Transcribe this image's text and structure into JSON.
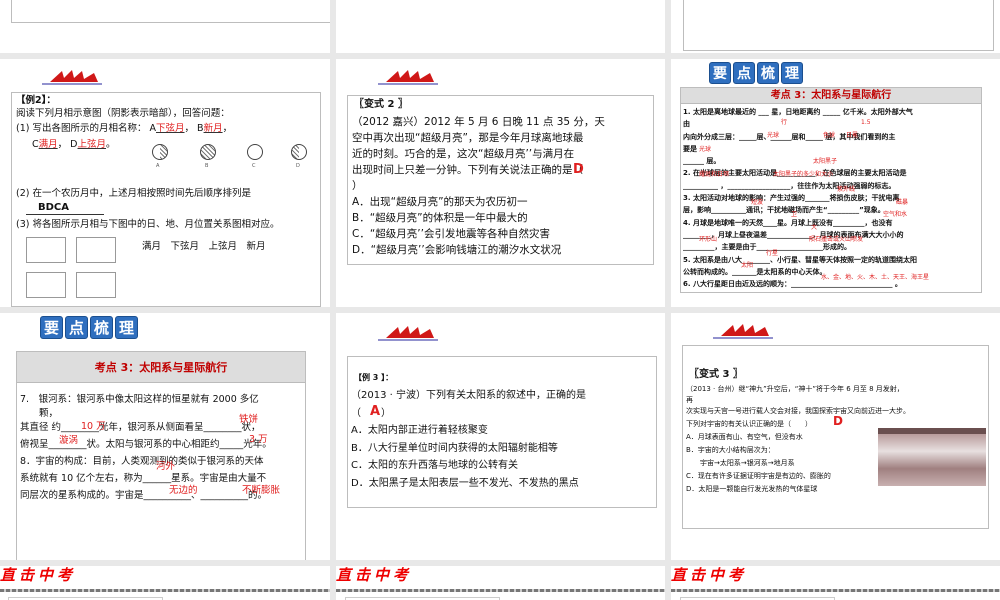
{
  "slides": {
    "ex2": {
      "title": "【例2】：",
      "intro": "阅读下列月相示意图（阴影表示暗部），回答问题：",
      "q1a": "(1) 写出各图所示的月相名称： A",
      "q1b": "， B",
      "q1c": "C",
      "q1d": "， D",
      "a1": "下弦月",
      "a2": "新月",
      "a3": "满月",
      "a4": "上弦月",
      "labels": [
        "A",
        "B",
        "C",
        "D"
      ],
      "q2": "(2) 在一个农历月中，上述月相按照时间先后顺序排列是",
      "a_order": "BDCA",
      "q3": "(3) 将各图所示月相与下图中的日、地、月位置关系图相对应。",
      "match": "满月　下弦月　上弦月　新月"
    },
    "v2": {
      "title": "〖变式 2 〗",
      "lines": [
        "（2012 嘉兴）2012 年 5 月 6 日晚 11 点 35 分，天",
        "空中再次出现“超级月亮”，那是今年月球离地球最",
        "近的时刻。巧合的是，这次“超级月亮’’与满月在",
        "出现时间上只差一分钟。下列有关说法正确的是（",
        "）"
      ],
      "answer": "D",
      "options": [
        "A．出现“超级月亮”的那天为农历初一",
        "B．“超级月亮”的体积是一年中最大的",
        "C．“超级月亮’’会引发地震等各种自然灾害",
        "D．“超级月亮’’会影响钱塘江的潮汐水文状况"
      ]
    },
    "review1": {
      "tiles": [
        "要",
        "点",
        "梳",
        "理"
      ],
      "header": "考点 3：太阳系与星际航行",
      "lines": [
        "1. 太阳是离地球最近的 ___ 星，日地距离约 _____ 亿千米。太阳外部大气",
        "   由",
        "   内向外分成三层：_____层、______层和_____ 层，其中我们看到的主",
        "   要是",
        "______ 层。",
        "2. 在光球层的主要太阳活动是___________，在色球层的主要太阳活动是",
        "   __________ ，__________________，往往作为太阳活动强弱的标志。",
        "3. 太阳活动对地球的影响：产生过强的_______将损伤皮肤；干扰电离",
        "   层，影响__________通讯；干扰地磁场而产生“_________”现象。",
        "4. 月球是地球唯一的天然____星。月球上既没有_________，也没有",
        "   ________，月球上昼夜温差_____________，月球的表面布满大大小小的",
        "   _________，主要是由于___________________形成的。",
        "5. 太阳系是由八大________、小行星、彗星等天体按照一定的轨道围绕太阳",
        "   公转而构成的。_______是太阳系的中心天体。",
        "6. 八大行星距日由近及远的顺为：_____________________________ 。"
      ],
      "answers": [
        "行",
        "1.5",
        "光球",
        "色球",
        "日冕",
        "光球",
        "太阳黑子",
        "耀斑和日珥",
        "太阳黑子的多少和大小",
        "紫外线",
        "短波",
        "磁暴",
        "卫",
        "空气和水",
        "大",
        "环形山",
        "陨石撞击或火山喷发",
        "行星",
        "太阳",
        "水、金、地、火、木、土、天王、海王星"
      ]
    },
    "review2": {
      "tiles": [
        "要",
        "点",
        "梳",
        "理"
      ],
      "header": "考点 3：太阳系与星际航行",
      "lines": [
        "7.　银河系：银河系中像太阳这样的恒星就有 2000 多亿",
        "　　颗，",
        "其直径 约________光年，银河系从侧面看呈________状，",
        "俯视呈________状。太阳与银河系的中心相距约_____光年。",
        "8．宇宙的构成：目前，人类观测到的类似于银河系的天体",
        "系统就有 10 亿个左右，称为______星系。宇宙是由大量不",
        "同层次的星系构成的。宇宙是__________、__________的。"
      ],
      "answers": [
        "10 万",
        "铁饼",
        "漩涡",
        "3 万",
        "河外",
        "无边的",
        "不断膨胀"
      ]
    },
    "ex3": {
      "title": "【例 3 】：",
      "lines": [
        "（2013 · 宁波）下列有关太阳系的叙述中，正确的是",
        "（　　）"
      ],
      "answer": "A",
      "options": [
        "A．太阳内部正进行着轻核聚变",
        "B．八大行星单位时间内获得的太阳辐射能相等",
        "C．太阳的东升西落与地球的公转有关",
        "D．太阳黑子是太阳表层一些不发光、不发热的黑点"
      ]
    },
    "v3": {
      "title": "〖变式 3 〗",
      "lines": [
        "（2013 · 台州）继“神九”升空后，“神十”将于今年 6 月至 8 月发射，",
        "再",
        "次实现与天宫一号进行载人交会对接，我国探索宇宙又向前迈进一大步。",
        "下列对宇宙的有关认识正确的是（　　）"
      ],
      "answer": "D",
      "options": [
        "A．月球表面有山、有空气，但没有水",
        "B．宇宙的大小结构层次为：",
        "　　宇宙→太阳系→银河系→地月系",
        "C．现在有许多证据证明宇宙是有边的、膨胀的",
        "D．太阳是一颗能自行发光发热的气体星球"
      ]
    },
    "footer_logo": "直击中考"
  },
  "colors": {
    "accent": "#2f6fbf",
    "answer": "#e02020",
    "heading": "#1a1aa0"
  }
}
